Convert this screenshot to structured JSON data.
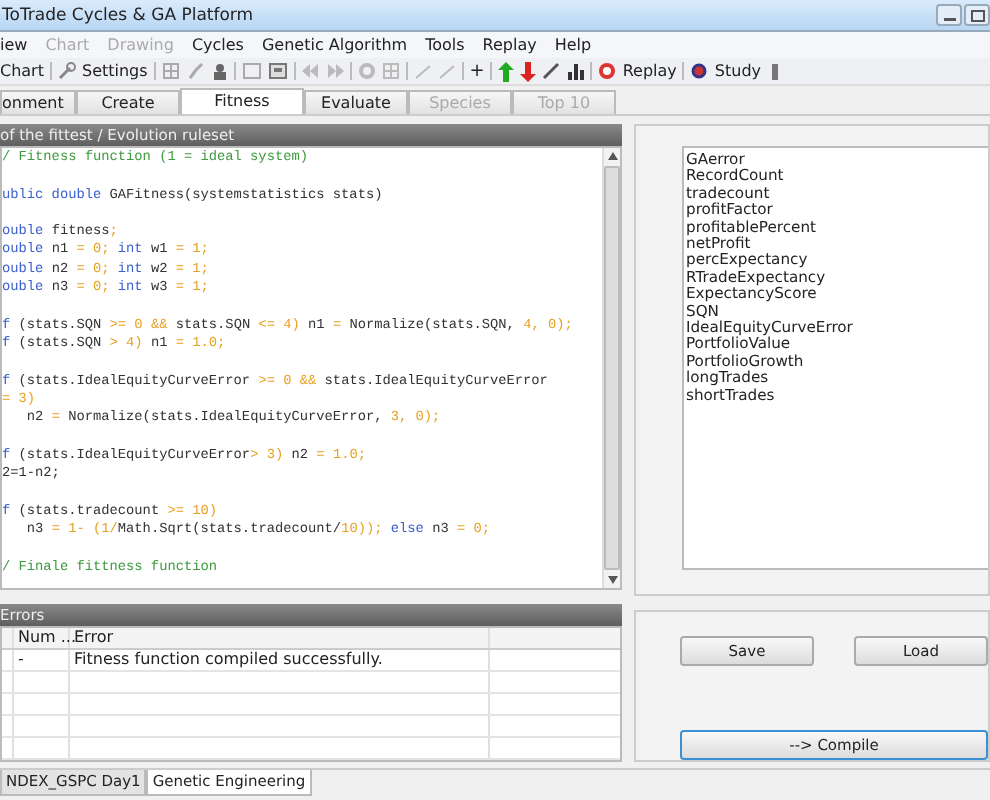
{
  "window": {
    "title": "ToTrade Cycles & GA Platform"
  },
  "menu": [
    {
      "label": "iew",
      "disabled": false
    },
    {
      "label": "Chart",
      "disabled": true
    },
    {
      "label": "Drawing",
      "disabled": true
    },
    {
      "label": "Cycles",
      "disabled": false
    },
    {
      "label": "Genetic Algorithm",
      "disabled": false
    },
    {
      "label": "Tools",
      "disabled": false
    },
    {
      "label": "Replay",
      "disabled": false
    },
    {
      "label": "Help",
      "disabled": false
    }
  ],
  "toolbar": {
    "chart_label": "Chart",
    "settings_label": "Settings",
    "plus": "+",
    "replay_label": "Replay",
    "study_label": "Study"
  },
  "tabs": [
    {
      "label": "onment",
      "selected": false,
      "disabled": false
    },
    {
      "label": "Create",
      "selected": false,
      "disabled": false
    },
    {
      "label": "Fitness",
      "selected": true,
      "disabled": false
    },
    {
      "label": "Evaluate",
      "selected": false,
      "disabled": false
    },
    {
      "label": "Species",
      "selected": false,
      "disabled": true
    },
    {
      "label": "Top 10",
      "selected": false,
      "disabled": true
    }
  ],
  "editor": {
    "title": "of the fittest / Evolution ruleset",
    "lines": [
      {
        "segs": [
          {
            "text": "/ Fitness function (1 = ideal system)",
            "kind": "comment"
          }
        ]
      },
      {
        "break_before": true,
        "segs": [
          {
            "text": "ublic double ",
            "kind": "kw"
          },
          {
            "text": "GAFitness(systemstatistics stats)",
            "kind": "plain"
          }
        ]
      },
      {
        "break_before": true,
        "segs": [
          {
            "text": "ouble ",
            "kind": "kw"
          },
          {
            "text": "fitness",
            "kind": "plain"
          },
          {
            "text": ";",
            "kind": "num"
          }
        ]
      },
      {
        "segs": [
          {
            "text": "ouble ",
            "kind": "kw"
          },
          {
            "text": "n1 ",
            "kind": "plain"
          },
          {
            "text": "= 0; ",
            "kind": "num"
          },
          {
            "text": "int ",
            "kind": "kw"
          },
          {
            "text": "w1 ",
            "kind": "plain"
          },
          {
            "text": "= 1;",
            "kind": "num"
          }
        ]
      },
      {
        "segs": [
          {
            "text": "ouble ",
            "kind": "kw"
          },
          {
            "text": "n2 ",
            "kind": "plain"
          },
          {
            "text": "= 0; ",
            "kind": "num"
          },
          {
            "text": "int ",
            "kind": "kw"
          },
          {
            "text": "w2 ",
            "kind": "plain"
          },
          {
            "text": "= 1;",
            "kind": "num"
          }
        ]
      },
      {
        "segs": [
          {
            "text": "ouble ",
            "kind": "kw"
          },
          {
            "text": "n3 ",
            "kind": "plain"
          },
          {
            "text": "= 0; ",
            "kind": "num"
          },
          {
            "text": "int ",
            "kind": "kw"
          },
          {
            "text": "w3 ",
            "kind": "plain"
          },
          {
            "text": "= 1;",
            "kind": "num"
          }
        ]
      },
      {
        "break_before": true,
        "segs": [
          {
            "text": "f ",
            "kind": "kw"
          },
          {
            "text": "(stats.SQN ",
            "kind": "plain"
          },
          {
            "text": ">= 0 && ",
            "kind": "num"
          },
          {
            "text": "stats.SQN ",
            "kind": "plain"
          },
          {
            "text": "<= 4) ",
            "kind": "num"
          },
          {
            "text": "n1 ",
            "kind": "plain"
          },
          {
            "text": "= ",
            "kind": "num"
          },
          {
            "text": "Normalize(stats.SQN, ",
            "kind": "plain"
          },
          {
            "text": "4, 0);",
            "kind": "num"
          }
        ]
      },
      {
        "segs": [
          {
            "text": "f ",
            "kind": "kw"
          },
          {
            "text": "(stats.SQN ",
            "kind": "plain"
          },
          {
            "text": "> 4) ",
            "kind": "num"
          },
          {
            "text": "n1 ",
            "kind": "plain"
          },
          {
            "text": "= 1.0;",
            "kind": "num"
          }
        ]
      },
      {
        "break_before": true,
        "segs": [
          {
            "text": "f ",
            "kind": "kw"
          },
          {
            "text": "(stats.IdealEquityCurveError ",
            "kind": "plain"
          },
          {
            "text": ">= 0 && ",
            "kind": "num"
          },
          {
            "text": "stats.IdealEquityCurveError",
            "kind": "plain"
          }
        ]
      },
      {
        "segs": [
          {
            "text": "= 3)",
            "kind": "num"
          }
        ]
      },
      {
        "segs": [
          {
            "text": "   n2 ",
            "kind": "plain"
          },
          {
            "text": "= ",
            "kind": "num"
          },
          {
            "text": "Normalize(stats.IdealEquityCurveError, ",
            "kind": "plain"
          },
          {
            "text": "3, 0);",
            "kind": "num"
          }
        ]
      },
      {
        "break_before": true,
        "segs": [
          {
            "text": "f ",
            "kind": "kw"
          },
          {
            "text": "(stats.IdealEquityCurveError",
            "kind": "plain"
          },
          {
            "text": "> 3) ",
            "kind": "num"
          },
          {
            "text": "n2 ",
            "kind": "plain"
          },
          {
            "text": "= 1.0;",
            "kind": "num"
          }
        ]
      },
      {
        "segs": [
          {
            "text": "2=1-n2;",
            "kind": "plain"
          }
        ]
      },
      {
        "break_before": true,
        "segs": [
          {
            "text": "f ",
            "kind": "kw"
          },
          {
            "text": "(stats.tradecount ",
            "kind": "plain"
          },
          {
            "text": ">= 10)",
            "kind": "num"
          }
        ]
      },
      {
        "segs": [
          {
            "text": "   n3 ",
            "kind": "plain"
          },
          {
            "text": "= 1- (1/",
            "kind": "num"
          },
          {
            "text": "Math.Sqrt(stats.tradecount/",
            "kind": "plain"
          },
          {
            "text": "10)); ",
            "kind": "num"
          },
          {
            "text": "else ",
            "kind": "kw"
          },
          {
            "text": "n3 ",
            "kind": "plain"
          },
          {
            "text": "= 0;",
            "kind": "num"
          }
        ]
      },
      {
        "break_before": true,
        "segs": [
          {
            "text": "/ Finale fittness function",
            "kind": "comment"
          }
        ]
      }
    ]
  },
  "errors": {
    "title": "Errors",
    "columns": [
      "Num ...",
      "Error"
    ],
    "rows": [
      {
        "num": "-",
        "error": "Fitness function compiled successfully."
      }
    ]
  },
  "variables": [
    "GAerror",
    "RecordCount",
    "tradecount",
    "profitFactor",
    "profitablePercent",
    "netProfit",
    "percExpectancy",
    "RTradeExpectancy",
    "ExpectancyScore",
    "SQN",
    "IdealEquityCurveError",
    "PortfolioValue",
    "PortfolioGrowth",
    "longTrades",
    "shortTrades"
  ],
  "buttons": {
    "save": "Save",
    "load": "Load",
    "compile": "--> Compile"
  },
  "bottom_tabs": [
    {
      "label": "NDEX_GSPC Day1",
      "selected": false
    },
    {
      "label": "Genetic Engineering",
      "selected": true
    }
  ]
}
